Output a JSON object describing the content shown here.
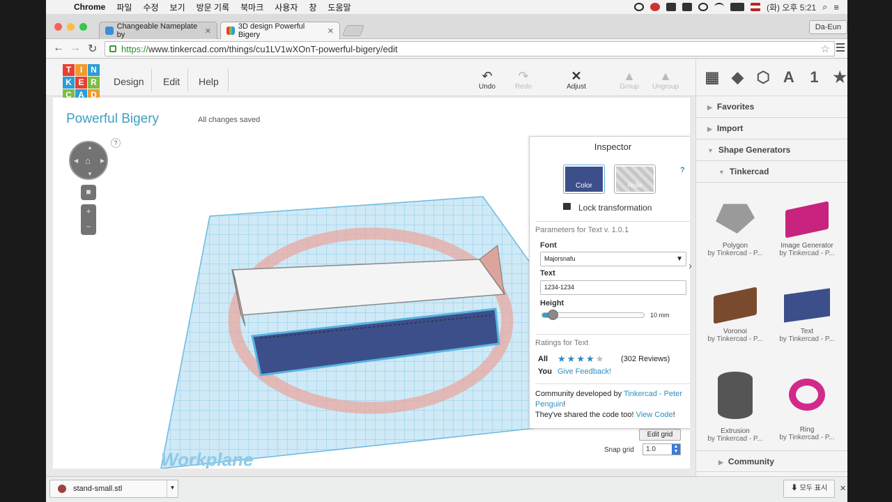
{
  "menubar": {
    "app": "Chrome",
    "items": [
      "파일",
      "수정",
      "보기",
      "방문 기록",
      "북마크",
      "사용자",
      "창",
      "도움말"
    ],
    "clock": "(화) 오후 5:21"
  },
  "tabs": [
    {
      "title": "Changeable Nameplate by",
      "favicon_color": "#3b8fd9"
    },
    {
      "title": "3D design Powerful Bigery",
      "favicon_color": "#e8a33a"
    }
  ],
  "profile": "Da-Eun",
  "omnibox": {
    "scheme": "https://",
    "rest": "www.tinkercad.com/things/cu1LV1wXOnT-powerful-bigery/edit"
  },
  "logo": {
    "letters": [
      "T",
      "I",
      "N",
      "K",
      "E",
      "R",
      "C",
      "A",
      "D"
    ],
    "colors": [
      "#e8402f",
      "#f39a2b",
      "#2c9ed6",
      "#2c9ed6",
      "#e8402f",
      "#7cbd42",
      "#7cbd42",
      "#2c9ed6",
      "#f39a2b"
    ]
  },
  "app_menu": [
    "Design",
    "Edit",
    "Help"
  ],
  "toolbar": {
    "undo": "Undo",
    "redo": "Redo",
    "adjust": "Adjust",
    "group": "Group",
    "ungroup": "Ungroup"
  },
  "project": {
    "title": "Powerful Bigery",
    "status": "All changes saved"
  },
  "viewport": {
    "workplane_label": "Workplane",
    "edit_grid": "Edit grid",
    "snap_label": "Snap grid",
    "snap_value": "1.0",
    "help_mark": "?"
  },
  "inspector": {
    "title": "Inspector",
    "color_label": "Color",
    "hole_label": "Hole",
    "color_hex": "#3d4f8a",
    "help": "?",
    "lock_label": "Lock transformation",
    "params_title": "Parameters for Text v. 1.0.1",
    "font_label": "Font",
    "font_value": "Majorsnafu",
    "text_label": "Text",
    "text_value": "1234-1234",
    "height_label": "Height",
    "height_value": "10 mm",
    "height_fraction": 0.1,
    "ratings_title": "Ratings for Text",
    "all_label": "All",
    "rating": 4.5,
    "reviews": "(302 Reviews)",
    "you_label": "You",
    "feedback": "Give Feedback!",
    "community_prefix": "Community developed by",
    "community_author": "Tinkercad - Peter Penguin",
    "community_suffix": "!",
    "shared_prefix": "They've shared the code too!",
    "view_code": "View Code",
    "view_code_suffix": "!"
  },
  "right_panel": {
    "tool_icons": [
      "grid-icon",
      "box-icon",
      "cube-icon",
      "letter-icon",
      "number-icon",
      "star-icon"
    ],
    "letter_glyph": "A",
    "number_glyph": "1",
    "sections": [
      "Favorites",
      "Import",
      "Shape Generators"
    ],
    "subsection": "Tinkercad",
    "community": "Community",
    "shapes": [
      {
        "name": "Polygon",
        "by": "by Tinkercad - P..."
      },
      {
        "name": "Image Generator",
        "by": "by Tinkercad - P..."
      },
      {
        "name": "Voronoi",
        "by": "by Tinkercad - P..."
      },
      {
        "name": "Text",
        "by": "by Tinkercad - P..."
      },
      {
        "name": "Extrusion",
        "by": "by Tinkercad - P..."
      },
      {
        "name": "Ring",
        "by": "by Tinkercad - P..."
      }
    ]
  },
  "downloads": {
    "file": "stand-small.stl",
    "show_all": "모두 표시"
  }
}
